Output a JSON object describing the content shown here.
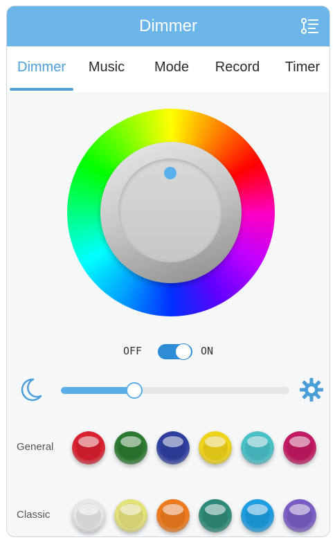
{
  "header": {
    "title": "Dimmer",
    "menu_icon": "list-settings-icon",
    "color": "#6cb5e8"
  },
  "tabs": [
    {
      "label": "Dimmer",
      "active": true
    },
    {
      "label": "Music",
      "active": false
    },
    {
      "label": "Mode",
      "active": false
    },
    {
      "label": "Record",
      "active": false
    },
    {
      "label": "Timer",
      "active": false
    }
  ],
  "accent_color": "#4a9fd8",
  "power": {
    "off_label": "OFF",
    "on_label": "ON",
    "state": "on"
  },
  "brightness": {
    "value": 0.32,
    "min_icon": "moon-icon",
    "max_icon": "sun-icon"
  },
  "presets": {
    "general": {
      "label": "General",
      "colors": [
        "#d8202e",
        "#2c7a30",
        "#2f3fa0",
        "#f0d41a",
        "#49c1c7",
        "#c21a62"
      ]
    },
    "classic": {
      "label": "Classic",
      "colors": [
        "#e6e6e6",
        "#e4e27a",
        "#ee7a1e",
        "#2e8a78",
        "#1e9de0",
        "#7a5dc4"
      ]
    }
  }
}
